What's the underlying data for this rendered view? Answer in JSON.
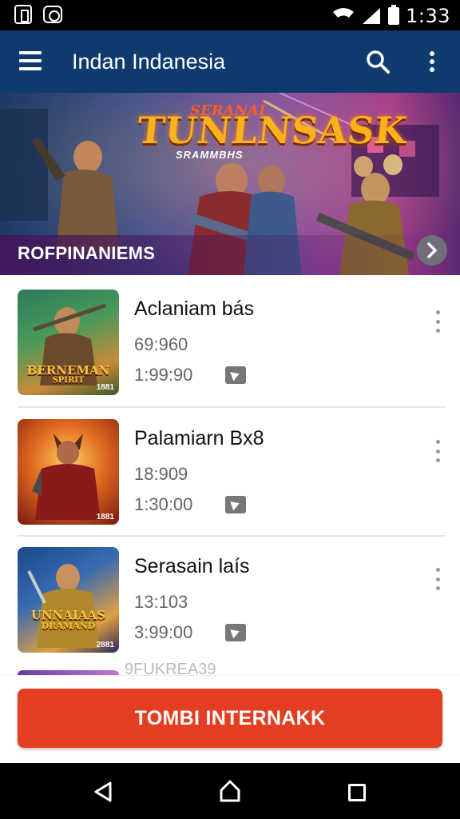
{
  "status_bar": {
    "time": "1:33",
    "icons": [
      "notification-icon",
      "message-icon",
      "wifi-icon",
      "signal-icon",
      "battery-icon"
    ]
  },
  "app_bar": {
    "title": "Indan Indanesia",
    "icons": [
      "menu-icon",
      "search-icon",
      "more-vert-icon"
    ],
    "color": "#0e3a6e"
  },
  "banner": {
    "pre_title": "SERANAI",
    "title": "TUNLNSASK",
    "subtitle": "SRAMMBHS",
    "caption": "ROFPINANIEMS"
  },
  "items": [
    {
      "title": "Aclaniam bás",
      "line1": "69:960",
      "line2": "1:99:90",
      "thumb_label": "BERNEMAN",
      "thumb_sub": "SPIRIT",
      "thumb_badge": "1881"
    },
    {
      "title": "Palamiarn Bx8",
      "line1": "18:909",
      "line2": "1:30:00",
      "thumb_label": "",
      "thumb_sub": "",
      "thumb_badge": "1881"
    },
    {
      "title": "Serasain laís",
      "line1": "13:103",
      "line2": "3:99:00",
      "thumb_label": "UNNAIAAS",
      "thumb_sub": "DRAMAND",
      "thumb_badge": "2881"
    }
  ],
  "peek_item": {
    "title": "9FUKREA39"
  },
  "primary_button": {
    "label": "TOMBI INTERNAKK",
    "color": "#e33d22"
  }
}
